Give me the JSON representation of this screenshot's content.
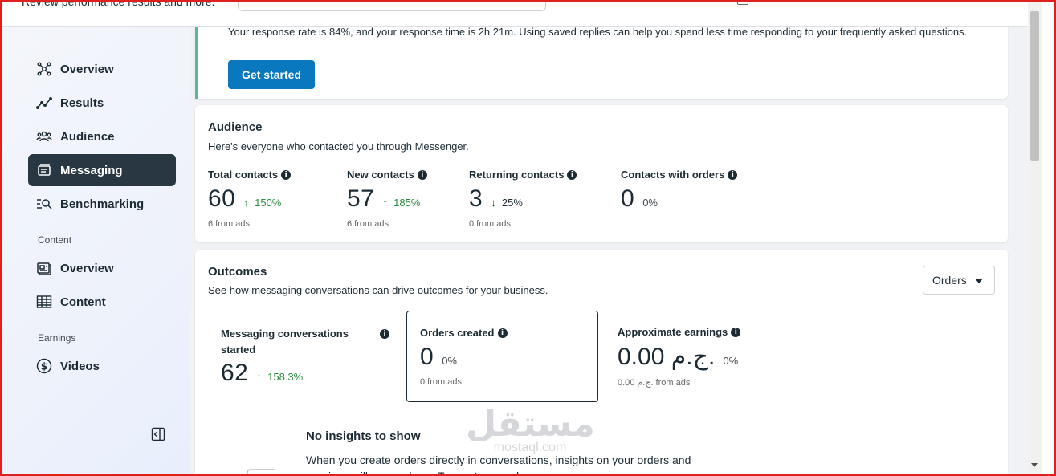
{
  "header": {
    "subtitle": "Review performance results and more."
  },
  "sidebar": {
    "items": [
      {
        "label": "Overview",
        "icon": "network-icon"
      },
      {
        "label": "Results",
        "icon": "trend-line-icon"
      },
      {
        "label": "Audience",
        "icon": "people-icon"
      },
      {
        "label": "Messaging",
        "icon": "messages-icon",
        "active": true
      },
      {
        "label": "Benchmarking",
        "icon": "benchmark-search-icon"
      }
    ],
    "section_content": "Content",
    "content_items": [
      {
        "label": "Overview",
        "icon": "content-overview-icon"
      },
      {
        "label": "Content",
        "icon": "table-grid-icon"
      }
    ],
    "section_earnings": "Earnings",
    "earnings_items": [
      {
        "label": "Videos",
        "icon": "dollar-circle-icon"
      }
    ]
  },
  "tip": {
    "text": "Your response rate is 84%, and your response time is 2h 21m. Using saved replies can help you spend less time responding to your frequently asked questions.",
    "button": "Get started"
  },
  "audience": {
    "title": "Audience",
    "subtitle": "Here's everyone who contacted you through Messenger.",
    "metrics": [
      {
        "label": "Total contacts",
        "value": "60",
        "change": "150%",
        "direction": "up",
        "foot": "6 from ads"
      },
      {
        "label": "New contacts",
        "value": "57",
        "change": "185%",
        "direction": "up",
        "foot": "6 from ads"
      },
      {
        "label": "Returning contacts",
        "value": "3",
        "change": "25%",
        "direction": "down",
        "foot": "0 from ads"
      },
      {
        "label": "Contacts with orders",
        "value": "0",
        "change": "0%",
        "direction": "none",
        "foot": ""
      }
    ]
  },
  "outcomes": {
    "title": "Outcomes",
    "subtitle": "See how messaging conversations can drive outcomes for your business.",
    "dropdown": "Orders",
    "metrics": [
      {
        "label": "Messaging conversations started",
        "value": "62",
        "change": "158.3%",
        "direction": "up",
        "foot": ""
      },
      {
        "label": "Orders created",
        "value": "0",
        "change": "0%",
        "direction": "none",
        "foot": "0 from ads"
      },
      {
        "label": "Approximate earnings",
        "value": "0.00 ج.م.",
        "change": "0%",
        "direction": "none",
        "foot": "0.00 ج.م. from ads"
      }
    ],
    "empty_title": "No insights to show",
    "empty_text": "When you create orders directly in conversations, insights on your orders and earnings will appear here. To create an order:"
  },
  "watermark": {
    "text": "مستقل",
    "subtext": "mostaql.com"
  },
  "colors": {
    "accent": "#0a78be",
    "active_nav": "#283742",
    "up": "#2b8a3e",
    "tip_border": "#5fb3a6"
  }
}
